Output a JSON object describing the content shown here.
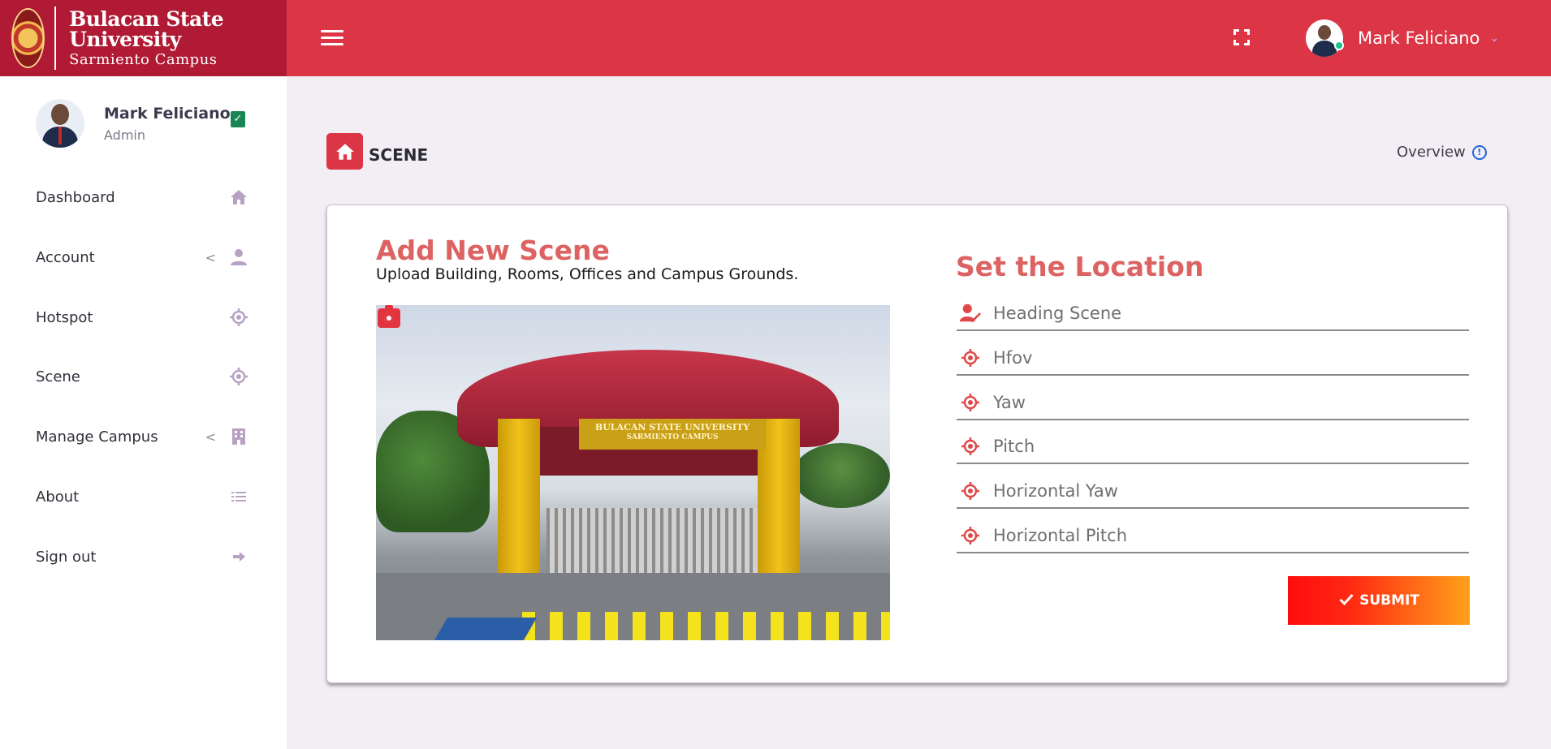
{
  "brand": {
    "line1": "Bulacan State University",
    "line2": "Sarmiento Campus"
  },
  "header": {
    "user_name": "Mark Feliciano",
    "caret": "⌄"
  },
  "sidebar": {
    "profile": {
      "name": "Mark Feliciano",
      "role": "Admin"
    },
    "items": [
      {
        "label": "Dashboard",
        "icon": "home-icon",
        "has_submenu": false
      },
      {
        "label": "Account",
        "icon": "user-icon",
        "has_submenu": true
      },
      {
        "label": "Hotspot",
        "icon": "crosshair-icon",
        "has_submenu": false
      },
      {
        "label": "Scene",
        "icon": "crosshair-icon",
        "has_submenu": false
      },
      {
        "label": "Manage Campus",
        "icon": "building-icon",
        "has_submenu": true
      },
      {
        "label": "About",
        "icon": "list-icon",
        "has_submenu": false
      },
      {
        "label": "Sign out",
        "icon": "arrow-right-icon",
        "has_submenu": false
      }
    ],
    "chevron": "<"
  },
  "page": {
    "title": "SCENE",
    "overview_label": "Overview"
  },
  "form": {
    "add_title": "Add New Scene",
    "add_subtitle": "Upload Building, Rooms, Offices and Campus Grounds.",
    "photo_sign_line1": "BULACAN STATE UNIVERSITY",
    "photo_sign_line2": "SARMIENTO CAMPUS",
    "location_title": "Set the Location",
    "fields": [
      {
        "placeholder": "Heading Scene",
        "value": "",
        "icon": "user-edit-icon"
      },
      {
        "placeholder": "Hfov",
        "value": "",
        "icon": "crosshair-icon"
      },
      {
        "placeholder": "Yaw",
        "value": "",
        "icon": "crosshair-icon"
      },
      {
        "placeholder": "Pitch",
        "value": "",
        "icon": "crosshair-icon"
      },
      {
        "placeholder": "Horizontal Yaw",
        "value": "",
        "icon": "crosshair-icon"
      },
      {
        "placeholder": "Horizontal Pitch",
        "value": "",
        "icon": "crosshair-icon"
      }
    ],
    "submit_label": "SUBMIT",
    "submit_icon": "check-icon"
  },
  "colors": {
    "topbar": "#dc3545",
    "brand_bg": "#b01a34",
    "accent_title": "#dd6363",
    "sidebar_icon": "#b8a2c4",
    "field_icon": "#e04848"
  }
}
